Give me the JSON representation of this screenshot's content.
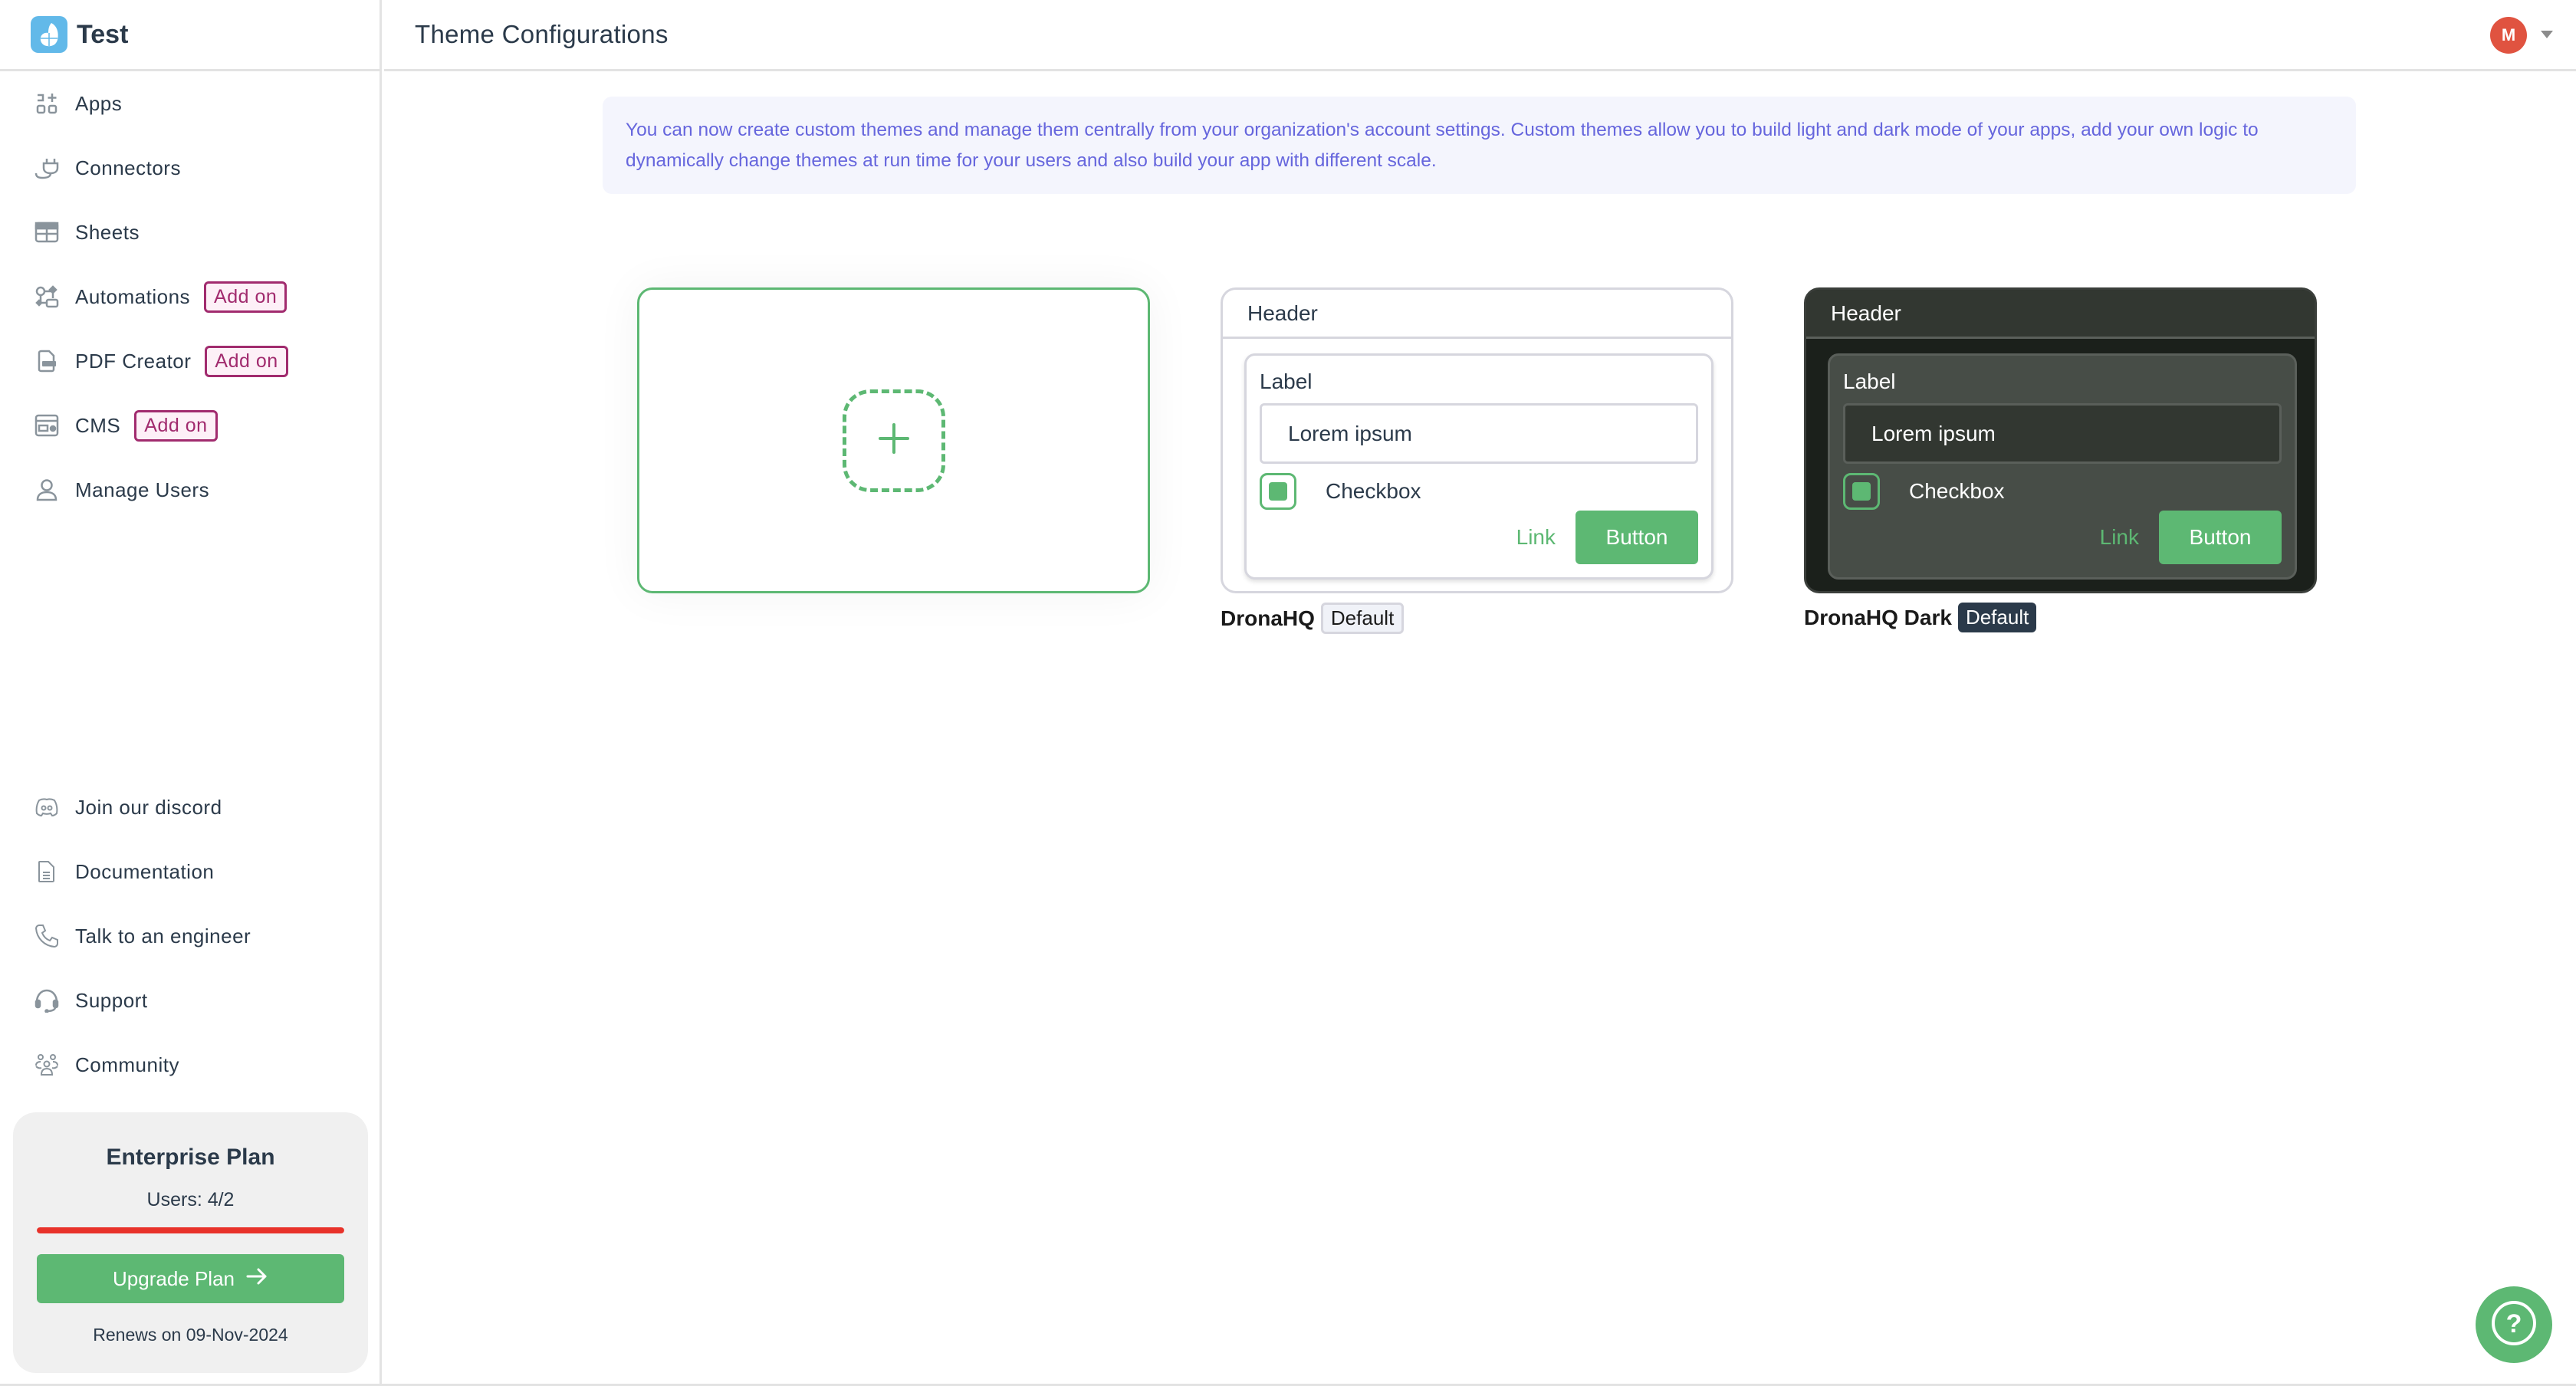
{
  "app": {
    "name": "Test"
  },
  "sidebar": {
    "items": [
      {
        "label": "Apps",
        "icon": "apps-icon"
      },
      {
        "label": "Connectors",
        "icon": "plug-icon"
      },
      {
        "label": "Sheets",
        "icon": "table-icon"
      },
      {
        "label": "Automations",
        "icon": "workflow-icon",
        "badge": "Add on"
      },
      {
        "label": "PDF Creator",
        "icon": "pdf-icon",
        "badge": "Add on"
      },
      {
        "label": "CMS",
        "icon": "cms-icon",
        "badge": "Add on"
      },
      {
        "label": "Manage Users",
        "icon": "user-icon"
      }
    ],
    "support_items": [
      {
        "label": "Join our discord",
        "icon": "discord-icon"
      },
      {
        "label": "Documentation",
        "icon": "document-icon"
      },
      {
        "label": "Talk to an engineer",
        "icon": "phone-icon"
      },
      {
        "label": "Support",
        "icon": "headset-icon"
      },
      {
        "label": "Community",
        "icon": "community-icon"
      }
    ],
    "plan": {
      "title": "Enterprise Plan",
      "users": "Users: 4/2",
      "usage_fraction": 1.0,
      "upgrade_label": "Upgrade Plan",
      "renewal": "Renews on 09-Nov-2024",
      "bar_color": "#e8322a"
    }
  },
  "header": {
    "title": "Theme Configurations",
    "avatar_initial": "M"
  },
  "banner": {
    "text": "You can now create custom themes and manage them centrally from your organization's account settings. Custom themes allow you to build light and dark mode of your apps, add your own logic to dynamically change themes at run time for your users and also build your app with different scale."
  },
  "themes": [
    {
      "name": "DronaHQ",
      "badge": "Default",
      "preview": {
        "header": "Header",
        "label": "Label",
        "input_value": "Lorem ipsum",
        "checkbox": "Checkbox",
        "link": "Link",
        "button": "Button"
      }
    },
    {
      "name": "DronaHQ Dark",
      "badge": "Default",
      "preview": {
        "header": "Header",
        "label": "Label",
        "input_value": "Lorem ipsum",
        "checkbox": "Checkbox",
        "link": "Link",
        "button": "Button"
      }
    }
  ],
  "colors": {
    "accent": "#5db873",
    "addon": "#a12b6e",
    "banner_text": "#6666dd",
    "avatar": "#e05340"
  }
}
